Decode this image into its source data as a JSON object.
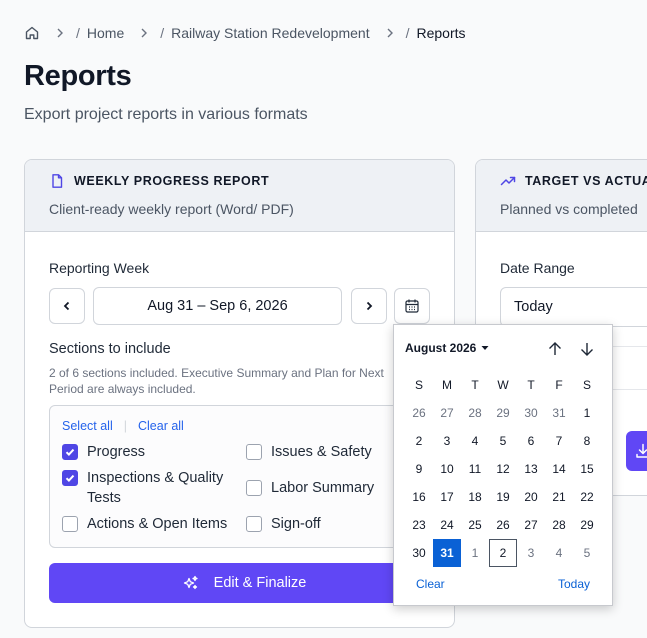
{
  "breadcrumb": {
    "home_icon": "home-icon",
    "items": [
      "Home",
      "Railway Station Redevelopment",
      "Reports"
    ]
  },
  "page": {
    "title": "Reports",
    "subtitle": "Export project reports in various formats"
  },
  "weekly_card": {
    "icon": "document-icon",
    "title": "WEEKLY PROGRESS REPORT",
    "description": "Client-ready weekly report (Word/ PDF)",
    "reporting_week_label": "Reporting Week",
    "week_value": "Aug 31 – Sep 6, 2026",
    "sections_label": "Sections to include",
    "sections_note_line1": "2 of 6 sections included. Executive Summary and Plan for Next",
    "sections_note_line2": "Period are always included.",
    "select_all": "Select all",
    "clear_all": "Clear all",
    "sections": [
      {
        "label": "Progress",
        "checked": true
      },
      {
        "label": "Inspections & Quality Tests",
        "checked": true
      },
      {
        "label": "Actions & Open Items",
        "checked": false
      },
      {
        "label": "Issues & Safety",
        "checked": false
      },
      {
        "label": "Labor Summary",
        "checked": false
      },
      {
        "label": "Sign-off",
        "checked": false
      }
    ],
    "sections_display": {
      "progress": "Progress",
      "inspections_line1": "Inspections & Quality",
      "inspections_line2": "Tests",
      "actions": "Actions & Open Items",
      "issues": "Issues & Safety",
      "labor": "Labor Summary",
      "signoff": "Sign-off"
    },
    "primary_button": "Edit & Finalize"
  },
  "target_card": {
    "icon": "trending-up-icon",
    "title": "TARGET VS ACTUAL",
    "description": "Planned vs completed",
    "date_range_label": "Date Range",
    "date_range_value": "Today",
    "download_icon": "download-icon"
  },
  "calendar": {
    "month_label": "August 2026",
    "weekdays": [
      "S",
      "M",
      "T",
      "W",
      "T",
      "F",
      "S"
    ],
    "weeks": [
      [
        "26",
        "27",
        "28",
        "29",
        "30",
        "31",
        "1"
      ],
      [
        "2",
        "3",
        "4",
        "5",
        "6",
        "7",
        "8"
      ],
      [
        "9",
        "10",
        "11",
        "12",
        "13",
        "14",
        "15"
      ],
      [
        "16",
        "17",
        "18",
        "19",
        "20",
        "21",
        "22"
      ],
      [
        "23",
        "24",
        "25",
        "26",
        "27",
        "28",
        "29"
      ],
      [
        "30",
        "31",
        "1",
        "2",
        "3",
        "4",
        "5"
      ]
    ],
    "selected_day": "31",
    "today_day": "2",
    "clear_label": "Clear",
    "today_label": "Today",
    "accent_color": "#0a61d5"
  },
  "colors": {
    "primary": "#6047f5",
    "checkbox": "#4f46e5",
    "link": "#2563eb"
  }
}
